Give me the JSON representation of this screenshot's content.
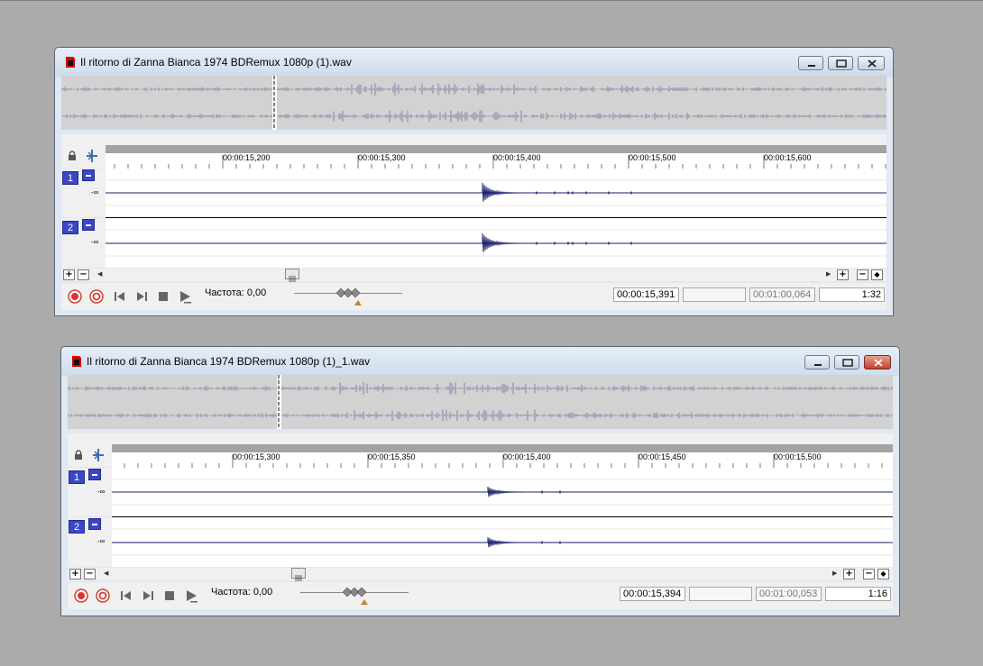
{
  "windows": [
    {
      "title": "Il ritorno di Zanna Bianca 1974 BDRemux 1080p (1).wav",
      "ruler_labels": [
        "00:00:15,200",
        "00:00:15,300",
        "00:00:15,400",
        "00:00:15,500",
        "00:00:15,600"
      ],
      "tracks": [
        {
          "number": "1",
          "db_label": "-∞"
        },
        {
          "number": "2",
          "db_label": "-∞"
        }
      ],
      "rate_label": "Частота: 0,00",
      "cursor_time": "00:00:15,391",
      "selection_length": "",
      "file_length": "00:01:00,064",
      "zoom_ratio": "1:32"
    },
    {
      "title": "Il ritorno di Zanna Bianca 1974 BDRemux 1080p (1)_1.wav",
      "ruler_labels": [
        "00:00:15,300",
        "00:00:15,350",
        "00:00:15,400",
        "00:00:15,450",
        "00:00:15,500"
      ],
      "tracks": [
        {
          "number": "1",
          "db_label": "-∞"
        },
        {
          "number": "2",
          "db_label": "-∞"
        }
      ],
      "rate_label": "Частота: 0,00",
      "cursor_time": "00:00:15,394",
      "selection_length": "",
      "file_length": "00:01:00,053",
      "zoom_ratio": "1:16"
    }
  ],
  "colors": {
    "desktop": "#ababab",
    "waveform_overview": "#9a9ab4",
    "waveform_track": "#1a1f6e",
    "track_badge": "#3b46c8",
    "close_button_active": "#c2412e"
  },
  "icons": {
    "app": "sound-forge-file-icon",
    "lock": "lock-icon",
    "snap": "snap-icon",
    "record": "record-icon",
    "loop": "loop-icon",
    "go_start": "go-to-start-icon",
    "go_end": "go-to-end-icon",
    "stop": "stop-icon",
    "play": "play-icon"
  }
}
